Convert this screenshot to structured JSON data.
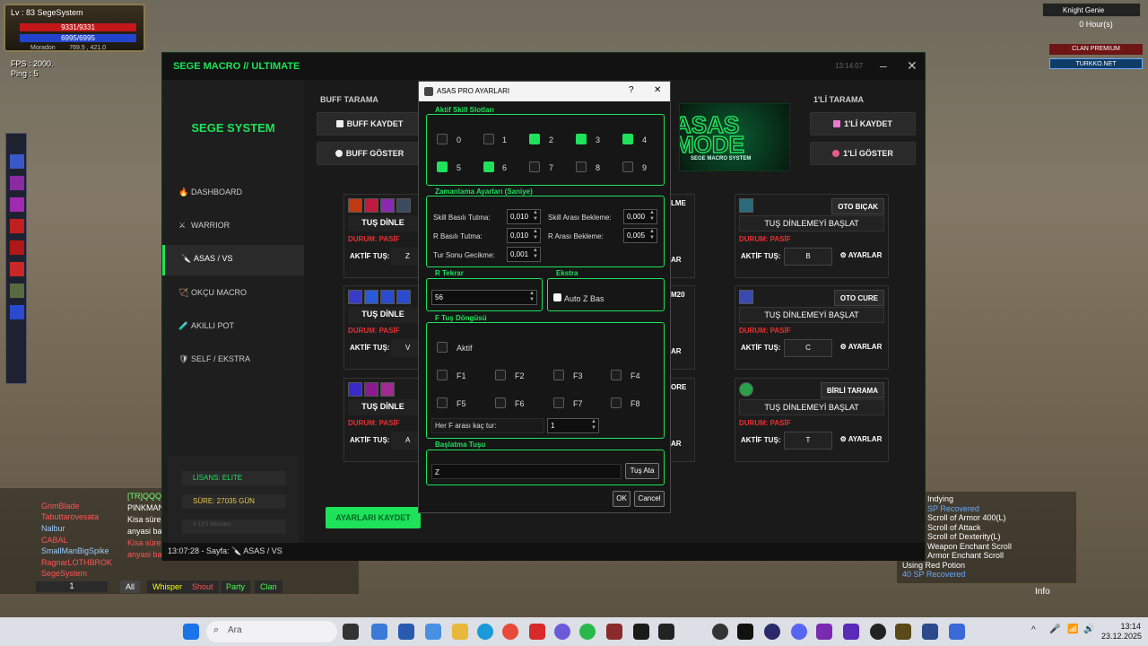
{
  "game_hud": {
    "level_name": "Lv : 83 SegeSystem",
    "hp": "9331/9331",
    "mp": "6995/6995",
    "location": "Moradon",
    "coordinates": "769.5 , 421.0",
    "fps": "FPS : 2000.",
    "ping": "Ping : 5",
    "knight_genie": "Knight Genie",
    "hours": "0 Hour(s)",
    "clan_premium": "CLAN PREMIUM",
    "turkko": "TURKKO.NET",
    "info": "Info"
  },
  "chat": {
    "names": [
      "GrimBlade",
      "Tabuttarovesata",
      "Nalbur",
      "CABAL",
      "SmallManBigSpike",
      "RagnarLOTHBROK",
      "SegeSystem"
    ],
    "messages": [
      "[TR]QQQC",
      "PINKMAN",
      "Kisa sürel",
      "anyasi ba",
      "Kisa sürel",
      "anyasi ba"
    ],
    "channel_value": "1",
    "tabs": [
      "All",
      "Whisper",
      "Shout",
      "Party",
      "Clan"
    ]
  },
  "combat_log": [
    "Indying",
    "SP Recovered",
    "Scroll of Armor 400(L)",
    "Scroll of Attack",
    "Scroll of Dexterity(L)",
    "Weapon Enchant Scroll",
    "Armor Enchant Scroll",
    "Using Red Potion",
    "40 SP Recovered"
  ],
  "taskbar": {
    "search_placeholder": "Ara",
    "time": "13:14",
    "date": "23.12.2025"
  },
  "app": {
    "title": "SEGE MACRO // ULTIMATE",
    "clock": "13:14:07",
    "brand": "SEGE SYSTEM",
    "nav": [
      {
        "label": "DASHBOARD",
        "icon": "🔥"
      },
      {
        "label": "WARRIOR",
        "icon": "⚔"
      },
      {
        "label": "ASAS / VS",
        "icon": "🔪"
      },
      {
        "label": "OKÇU MACRO",
        "icon": "🏹"
      },
      {
        "label": "AKILLI POT",
        "icon": "🧪"
      },
      {
        "label": "SELF / EKSTRA",
        "icon": "🛡"
      }
    ],
    "license": "LİSANS: ELITE",
    "duration": "SÜRE: 27035 GÜN",
    "version": "V 13.5 (Module)",
    "buff_section": "BUFF TARAMA",
    "buff_save": "BUFF KAYDET",
    "buff_show": "BUFF GÖSTER",
    "one_section": "1'Lİ TARAMA",
    "one_save": "1'Lİ KAYDET",
    "one_show": "1'Lİ GÖSTER",
    "banner_text": "ASAS MODE",
    "banner_sub": "SEGE MACRO SYSTEM",
    "save_settings": "AYARLARI KAYDET",
    "status_bar": "13:07:28 - Sayfa: 🔪 ASAS / VS",
    "left_cards": [
      {
        "btn": "TUŞ DİNLE",
        "status": "DURUM: PASİF",
        "key_label": "AKTİF TUŞ:",
        "key": "Z"
      },
      {
        "btn": "TUŞ DİNLE",
        "status": "DURUM: PASİF",
        "key_label": "AKTİF TUŞ:",
        "key": "V"
      },
      {
        "btn": "TUŞ DİNLE",
        "status": "DURUM: PASİF",
        "key_label": "AKTİF TUŞ:",
        "key": "A"
      }
    ],
    "mid_right_titles": [
      "LME",
      "M20",
      "ORE"
    ],
    "mid_right_bottoms": [
      "AR",
      "AR",
      "AR"
    ],
    "right_cards": [
      {
        "title": "OTO BIÇAK",
        "btn": "TUŞ DİNLEMEYİ BAŞLAT",
        "status": "DURUM: PASİF",
        "key_label": "AKTİF TUŞ:",
        "key": "B",
        "settings": "⚙ AYARLAR"
      },
      {
        "title": "OTO CURE",
        "btn": "TUŞ DİNLEMEYİ BAŞLAT",
        "status": "DURUM: PASİF",
        "key_label": "AKTİF TUŞ:",
        "key": "C",
        "settings": "⚙ AYARLAR"
      },
      {
        "title": "BİRLİ TARAMA",
        "btn": "TUŞ DİNLEMEYİ BAŞLAT",
        "status": "DURUM: PASİF",
        "key_label": "AKTİF TUŞ:",
        "key": "T",
        "settings": "⚙ AYARLAR"
      }
    ]
  },
  "dialog": {
    "title": "ASAS PRO AYARLARI",
    "help": "?",
    "close": "✕",
    "slots_title": "Aktif Skill Slotları",
    "slots": [
      {
        "label": "0",
        "checked": false
      },
      {
        "label": "1",
        "checked": false
      },
      {
        "label": "2",
        "checked": true
      },
      {
        "label": "3",
        "checked": true
      },
      {
        "label": "4",
        "checked": true
      },
      {
        "label": "5",
        "checked": true
      },
      {
        "label": "6",
        "checked": true
      },
      {
        "label": "7",
        "checked": false
      },
      {
        "label": "8",
        "checked": false
      },
      {
        "label": "9",
        "checked": false
      }
    ],
    "timing_title": "Zamanlama Ayarları (Saniye)",
    "skill_hold_label": "Skill Basılı Tutma:",
    "skill_hold_value": "0,010",
    "skill_wait_label": "Skill Arası Bekleme:",
    "skill_wait_value": "0,000",
    "r_hold_label": "R Basılı Tutma:",
    "r_hold_value": "0,010",
    "r_wait_label": "R Arası Bekleme:",
    "r_wait_value": "0,005",
    "tour_delay_label": "Tur Sonu Gecikme:",
    "tour_delay_value": "0,001",
    "r_repeat_title": "R Tekrar",
    "r_repeat_value": "56",
    "extra_title": "Ekstra",
    "auto_z_label": "Auto Z Bas",
    "f_cycle_title": "F Tuş Döngüsü",
    "active_label": "Aktif",
    "f_keys": [
      "F1",
      "F2",
      "F3",
      "F4",
      "F5",
      "F6",
      "F7",
      "F8"
    ],
    "f_per_tour_label": "Her F arası kaç tur:",
    "f_per_tour_value": "1",
    "start_key_title": "Başlatma Tuşu",
    "start_key_value": "Z",
    "assign_key": "Tuş Ata",
    "ok": "OK",
    "cancel": "Cancel"
  }
}
